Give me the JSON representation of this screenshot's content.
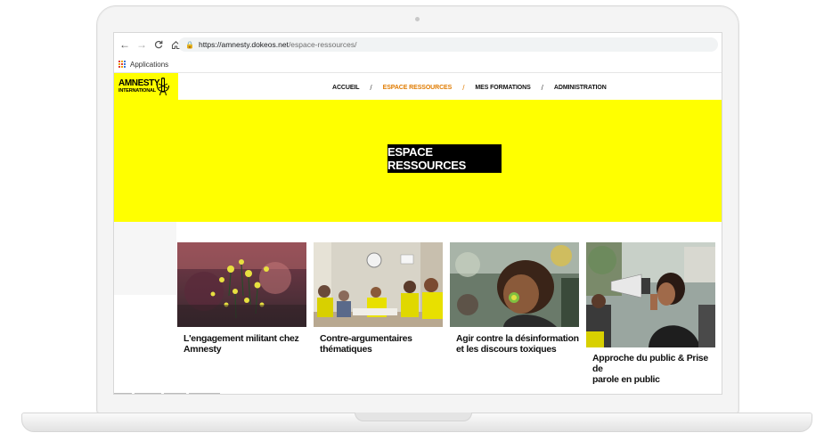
{
  "browser": {
    "url_host": "https://amnesty.dokeos.net",
    "url_path": "/espace-ressources/",
    "bookmarks": [
      "Applications"
    ]
  },
  "site": {
    "logo": {
      "line1": "AMNESTY",
      "line2": "INTERNATIONAL"
    },
    "nav": [
      {
        "label": "ACCUEIL",
        "active": false
      },
      {
        "label": "ESPACE RESSOURCES",
        "active": true
      },
      {
        "label": "MES FORMATIONS",
        "active": false
      },
      {
        "label": "ADMINISTRATION",
        "active": false
      }
    ],
    "separator": "/",
    "hero_title": "ESPACE RESSOURCES",
    "cards": [
      {
        "title_line1": "L'engagement militant chez",
        "title_line2": "Amnesty",
        "title_line3": ""
      },
      {
        "title_line1": "Contre-argumentaires",
        "title_line2": "thématiques",
        "title_line3": ""
      },
      {
        "title_line1": "Agir contre la désinformation",
        "title_line2": "et les discours toxiques",
        "title_line3": ""
      },
      {
        "title_line1": "Approche du public & Prise de",
        "title_line2": "parole en public",
        "title_line3": ""
      }
    ]
  },
  "colors": {
    "brand_yellow": "#ffff00",
    "active_nav": "#e07b00",
    "hero_title_bg": "#000000"
  },
  "icons": [
    "back-arrow-icon",
    "forward-arrow-icon",
    "reload-icon",
    "home-icon",
    "lock-icon",
    "apps-grid-icon",
    "amnesty-candle-icon"
  ]
}
